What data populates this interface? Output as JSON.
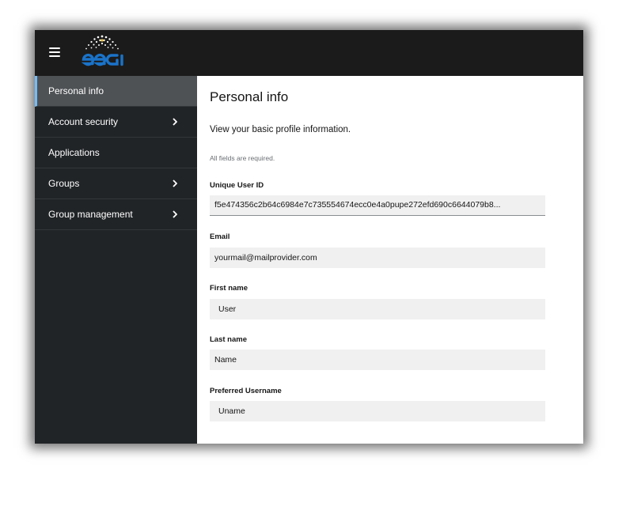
{
  "header": {
    "menu_icon": "hamburger-menu-icon",
    "logo_icon": "egi-logo",
    "logo_text": "egi",
    "colors": {
      "background": "#1b1b1b",
      "logo_blue": "#1a73c9"
    }
  },
  "sidebar": {
    "items": [
      {
        "label": "Personal info",
        "active": true,
        "has_chevron": false
      },
      {
        "label": "Account security",
        "active": false,
        "has_chevron": true
      },
      {
        "label": "Applications",
        "active": false,
        "has_chevron": false
      },
      {
        "label": "Groups",
        "active": false,
        "has_chevron": true
      },
      {
        "label": "Group management",
        "active": false,
        "has_chevron": true
      }
    ],
    "colors": {
      "background": "#212427",
      "active_background": "#4f5255",
      "active_indicator": "#73bcf7"
    }
  },
  "main": {
    "title": "Personal info",
    "subtitle": "View your basic profile information.",
    "required_note": "All fields are required.",
    "fields": {
      "unique_user_id": {
        "label": "Unique User ID",
        "value": "f5e474356c2b64c6984e7c735554674ecc0e4a0pupe272efd690c6644079b8..."
      },
      "email": {
        "label": "Email",
        "value": "yourmail@mailprovider.com"
      },
      "first_name": {
        "label": "First name",
        "value": "User"
      },
      "last_name": {
        "label": "Last name",
        "value": "Name"
      },
      "preferred_username": {
        "label": "Preferred Username",
        "value": "Uname"
      }
    }
  }
}
